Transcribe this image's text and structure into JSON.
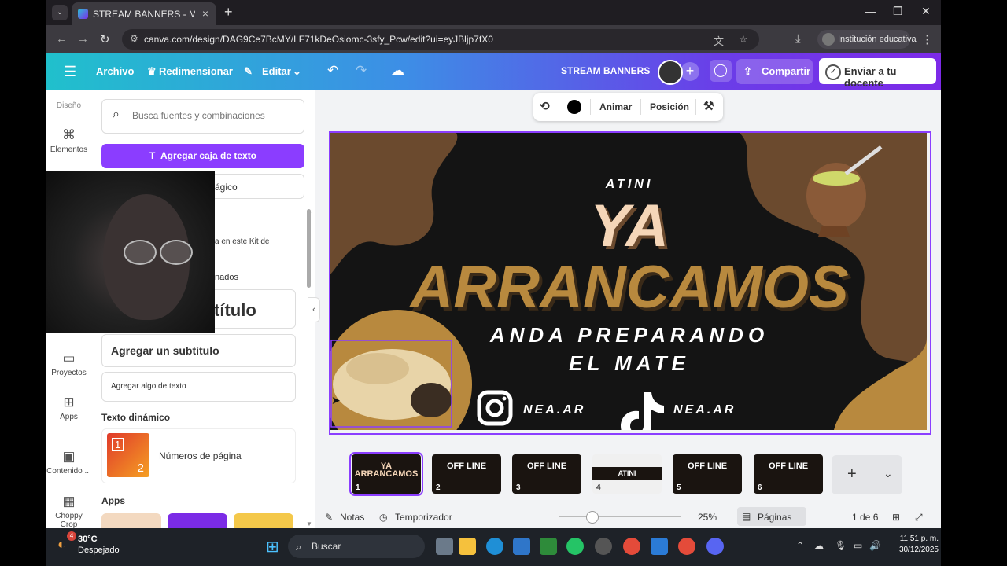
{
  "browser": {
    "tab_title": "STREAM BANNERS - Multi-desi",
    "url": "canva.com/design/DAG9Ce7BcMY/LF71kDeOsiomc-3sfy_Pcw/edit?ui=eyJBljp7fX0",
    "profile_label": "Institución educativa"
  },
  "header": {
    "menu": [
      "Archivo",
      "Redimensionar",
      "Editar"
    ],
    "design_title": "STREAM BANNERS",
    "share": "Compartir",
    "send_teacher": "Enviar a tu docente"
  },
  "rail": {
    "items": [
      "Diseño",
      "Elementos",
      "Proyectos",
      "Apps",
      "Contenido ...",
      "Choppy Crop"
    ]
  },
  "panel": {
    "search_placeholder": "Busca fuentes y combinaciones",
    "add_textbox": "Agregar caja de texto",
    "magic_partial": "ágico",
    "brand_partial": "a en este Kit de",
    "combos_partial": "nados",
    "title_partial": "título",
    "subtitle": "Agregar un subtítulo",
    "body_text": "Agregar algo de texto",
    "dynamic_heading": "Texto dinámico",
    "page_numbers": "Números de página",
    "page_num_a": "1",
    "page_num_b": "2",
    "apps_heading": "Apps"
  },
  "toolbar": {
    "animate": "Animar",
    "position": "Posición"
  },
  "banner": {
    "kicker": "ATINI",
    "line1": "YA",
    "line2": "ARRANCAMOS",
    "tag1": "ANDA PREPARANDO",
    "tag2": "EL MATE",
    "ig_handle": "NEA.AR",
    "tt_handle": "NEA.AR",
    "colors": {
      "background": "#141414",
      "brown": "#6b4a2e",
      "gold": "#b8893e",
      "cream": "#f5d6b8"
    }
  },
  "pages": [
    {
      "num": "1",
      "title": "YA ARRANCAMOS",
      "selected": true
    },
    {
      "num": "2",
      "title": "OFF LINE"
    },
    {
      "num": "3",
      "title": "OFF LINE"
    },
    {
      "num": "4",
      "title": "ATINI"
    },
    {
      "num": "5",
      "title": "OFF LINE"
    },
    {
      "num": "6",
      "title": "OFF LINE"
    }
  ],
  "bottom": {
    "notes": "Notas",
    "timer": "Temporizador",
    "zoom": "25%",
    "pages_label": "Páginas",
    "page_counter": "1 de 6"
  },
  "taskbar": {
    "temp": "30°C",
    "weather": "Despejado",
    "weather_badge": "4",
    "search": "Buscar",
    "time": "11:51 p. m.",
    "date": "30/12/2025"
  }
}
